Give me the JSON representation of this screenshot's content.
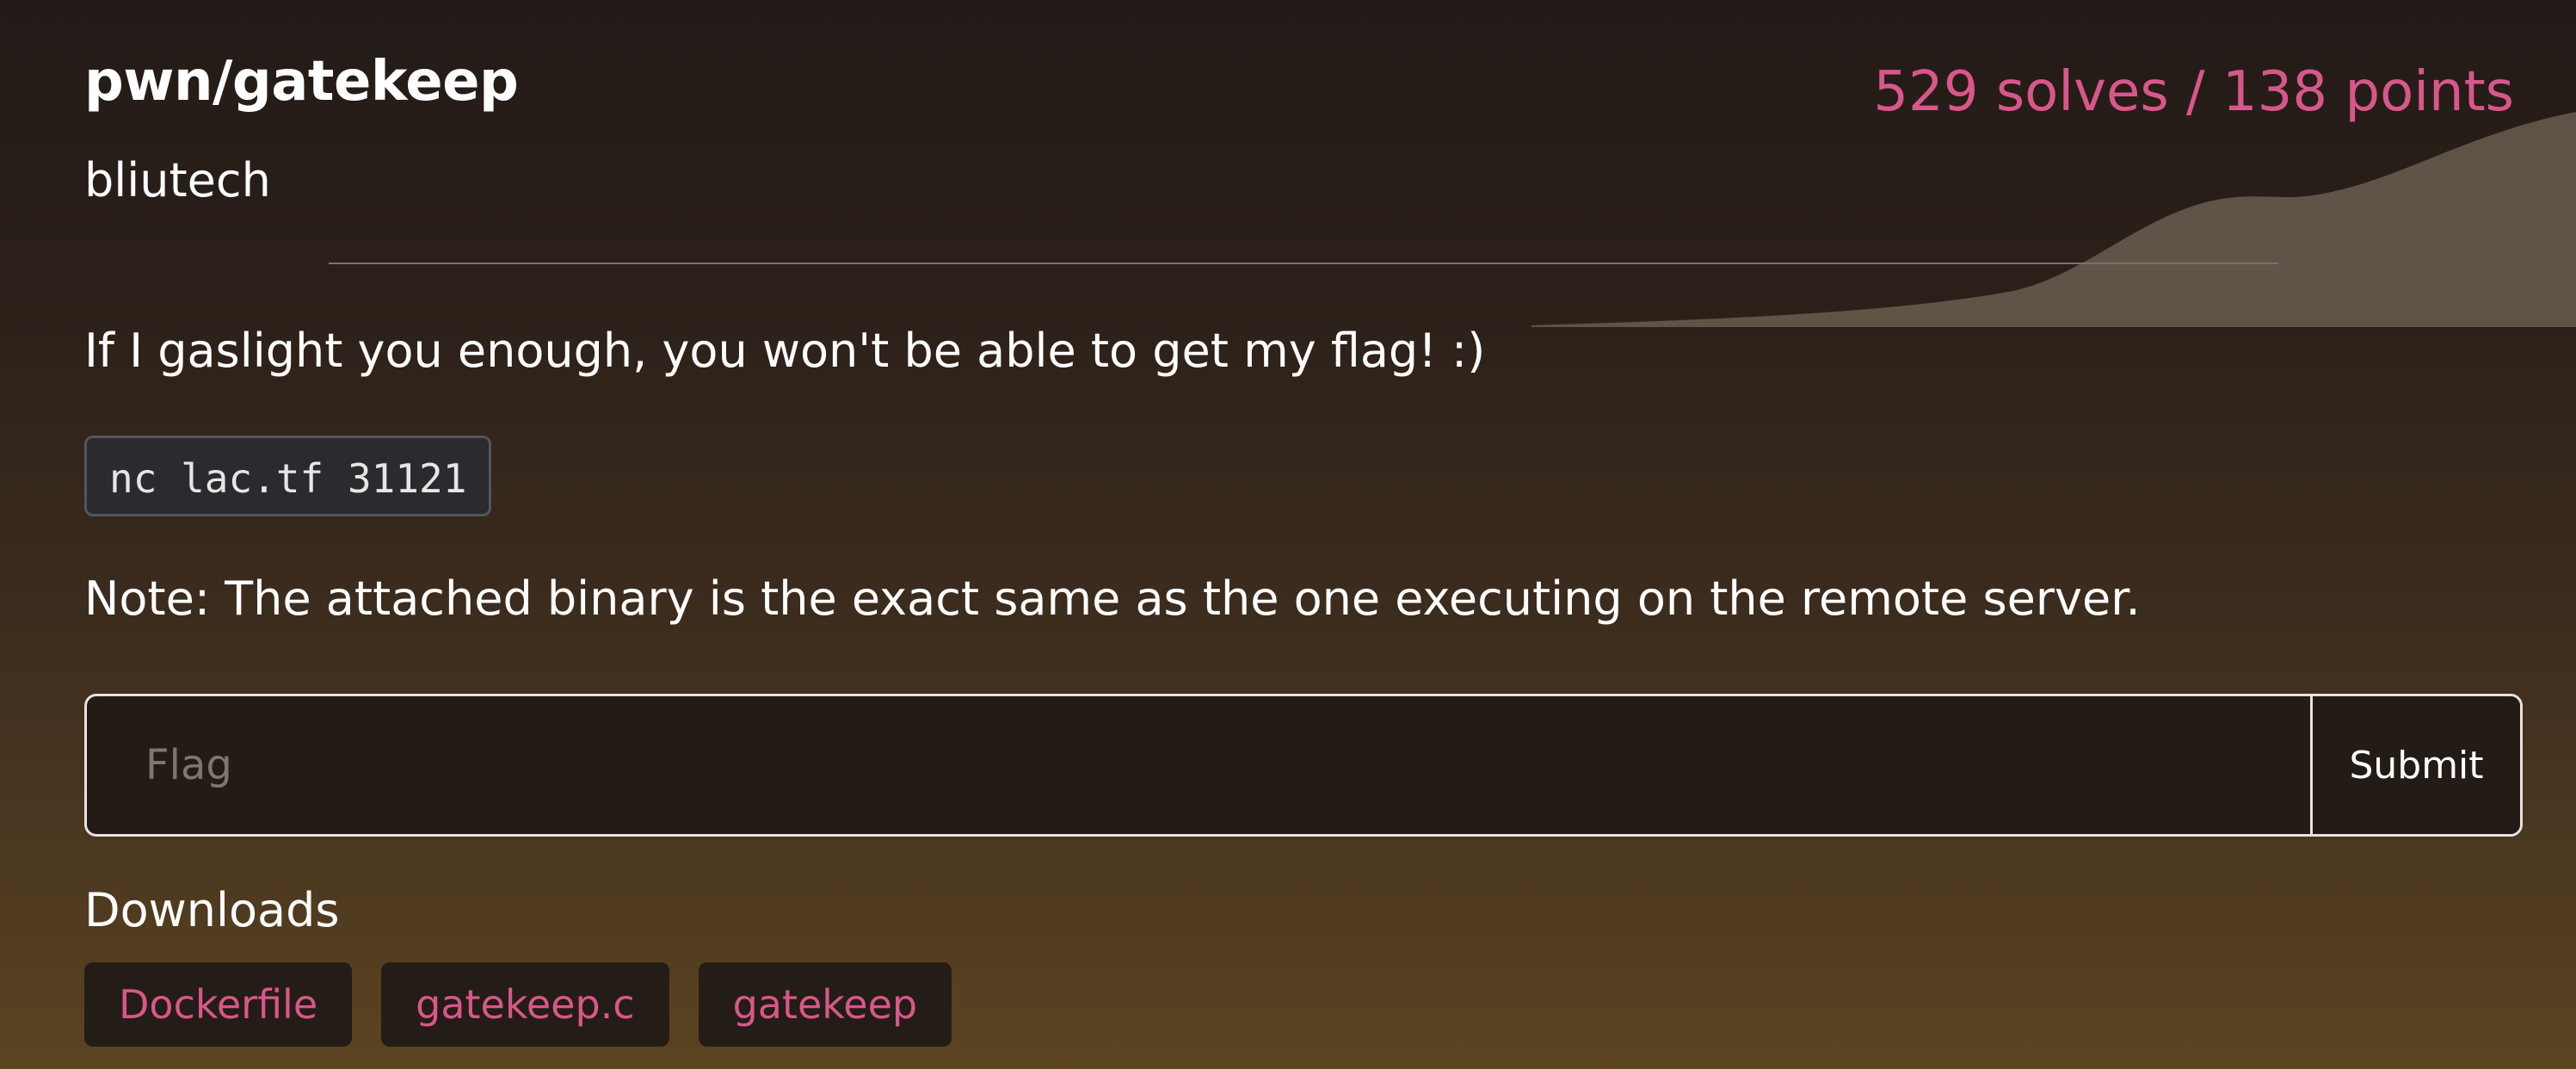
{
  "challenge": {
    "title": "pwn/gatekeep",
    "author": "bliutech",
    "stats": "529 solves / 138 points",
    "description": "If I gaslight you enough, you won't be able to get my flag! :)",
    "command": "nc lac.tf 31121",
    "note": "Note: The attached binary is the exact same as the one executing on the remote server."
  },
  "flag_form": {
    "placeholder": "Flag",
    "value": "",
    "submit_label": "Submit"
  },
  "downloads": {
    "heading": "Downloads",
    "files": [
      "Dockerfile",
      "gatekeep.c",
      "gatekeep"
    ]
  },
  "colors": {
    "accent": "#d8578a",
    "graph_fill": "#6a5d50"
  }
}
